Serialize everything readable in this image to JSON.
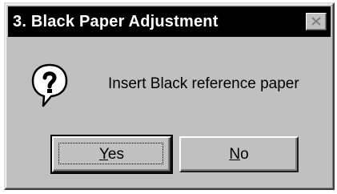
{
  "dialog": {
    "title": "3. Black Paper Adjustment",
    "message": "Insert Black reference paper",
    "icon": "question-icon"
  },
  "buttons": {
    "yes": {
      "mnemonic": "Y",
      "rest": "es"
    },
    "no": {
      "mnemonic": "N",
      "rest": "o"
    }
  },
  "colors": {
    "titlebar": "#000000",
    "face": "#c0c0c0",
    "title_text": "#ffffff"
  }
}
